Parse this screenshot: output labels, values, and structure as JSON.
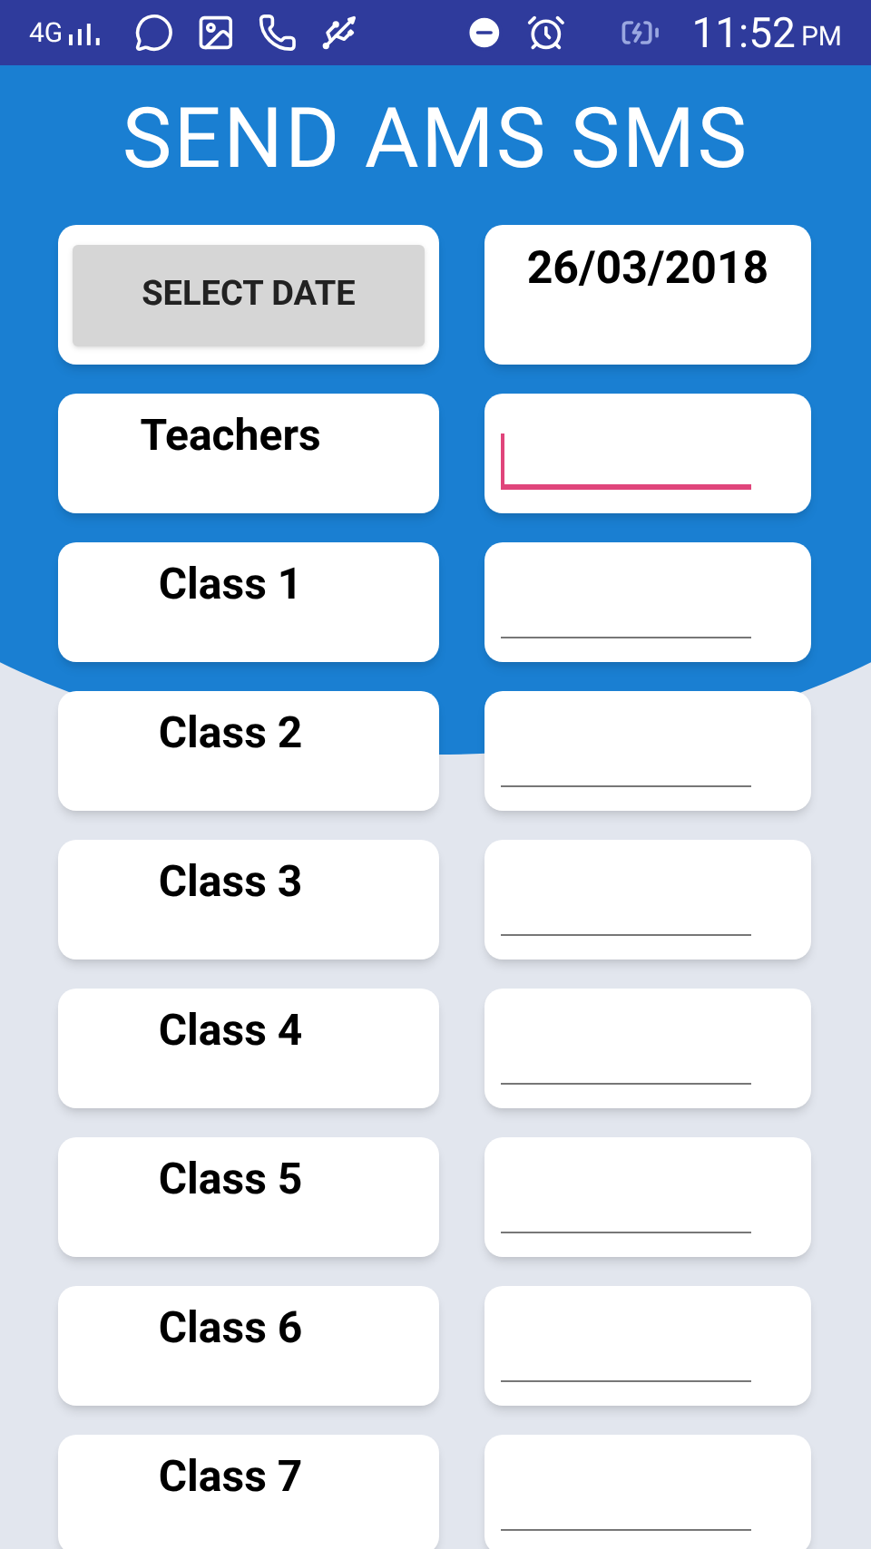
{
  "status_bar": {
    "network": "4G",
    "time": "11:52",
    "meridiem": "PM"
  },
  "title": "SEND AMS SMS",
  "date_button": {
    "label": "SELECT DATE"
  },
  "date_value": "26/03/2018",
  "rows": [
    {
      "label": "Teachers",
      "focused": true
    },
    {
      "label": "Class 1",
      "focused": false
    },
    {
      "label": "Class 2",
      "focused": false
    },
    {
      "label": "Class 3",
      "focused": false
    },
    {
      "label": "Class 4",
      "focused": false
    },
    {
      "label": "Class 5",
      "focused": false
    },
    {
      "label": "Class 6",
      "focused": false
    },
    {
      "label": "Class 7",
      "focused": false
    }
  ]
}
